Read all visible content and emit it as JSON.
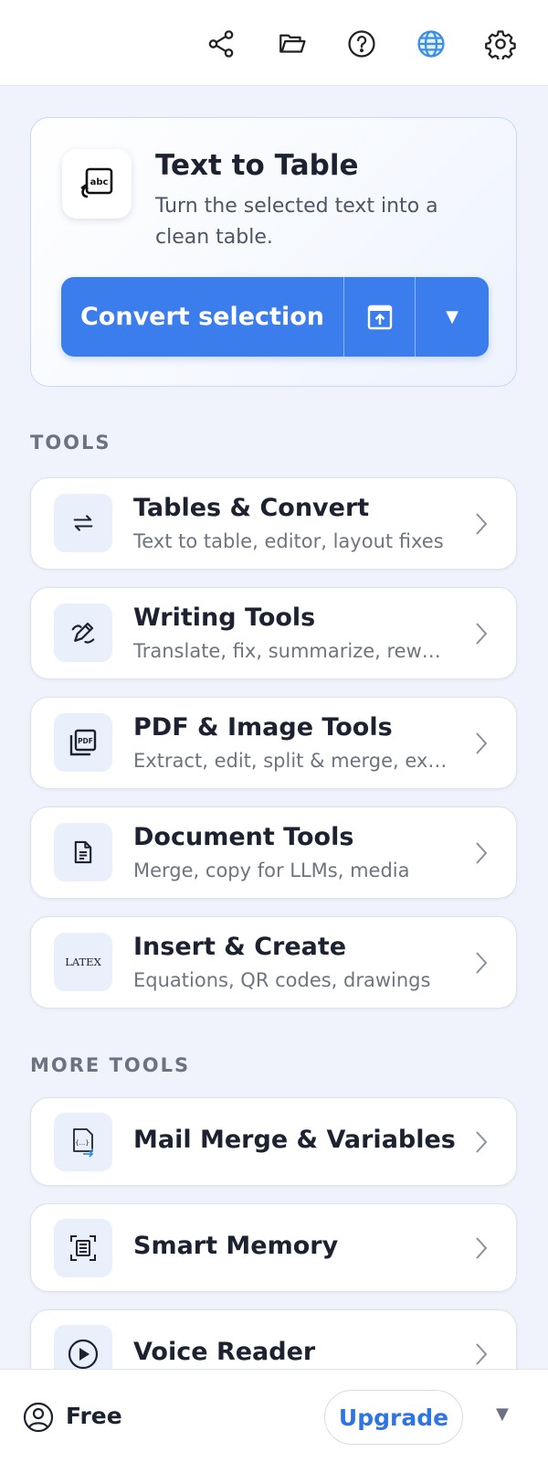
{
  "toolbar": {
    "icons": [
      "share-icon",
      "folder-icon",
      "help-icon",
      "globe-icon",
      "settings-icon"
    ],
    "accent_globe_color": "#3a8ee6"
  },
  "hero": {
    "title": "Text to Table",
    "description": "Turn the selected text into a clean table.",
    "icon": "text-to-table-icon",
    "primary_button": "Convert selection",
    "export_icon": "export-icon",
    "dropdown_glyph": "▼",
    "accent": "#3b7ded"
  },
  "tools": {
    "section_label": "TOOLS",
    "items": [
      {
        "title": "Tables & Convert",
        "subtitle": "Text to table, editor, layout fixes",
        "icon": "swap-arrows-icon"
      },
      {
        "title": "Writing Tools",
        "subtitle": "Translate, fix, summarize, rewrite",
        "icon": "pen-icon"
      },
      {
        "title": "PDF & Image Tools",
        "subtitle": "Extract, edit, split & merge, exp…",
        "icon": "pdf-icon",
        "icon_text": "PDF"
      },
      {
        "title": "Document Tools",
        "subtitle": "Merge, copy for LLMs, media",
        "icon": "document-icon"
      },
      {
        "title": "Insert & Create",
        "subtitle": "Equations, QR codes, drawings",
        "icon": "latex-icon",
        "icon_text": "LATEX"
      }
    ]
  },
  "more_tools": {
    "section_label": "MORE TOOLS",
    "items": [
      {
        "title": "Mail Merge & Variables",
        "icon": "mail-merge-icon",
        "icon_text": "{...}"
      },
      {
        "title": "Smart Memory",
        "icon": "memory-icon"
      },
      {
        "title": "Voice Reader",
        "icon": "play-icon"
      }
    ]
  },
  "footer": {
    "plan_label": "Free",
    "plan_icon": "user-circle-icon",
    "upgrade_label": "Upgrade",
    "caret": "▼",
    "upgrade_color": "#2f74e6"
  }
}
